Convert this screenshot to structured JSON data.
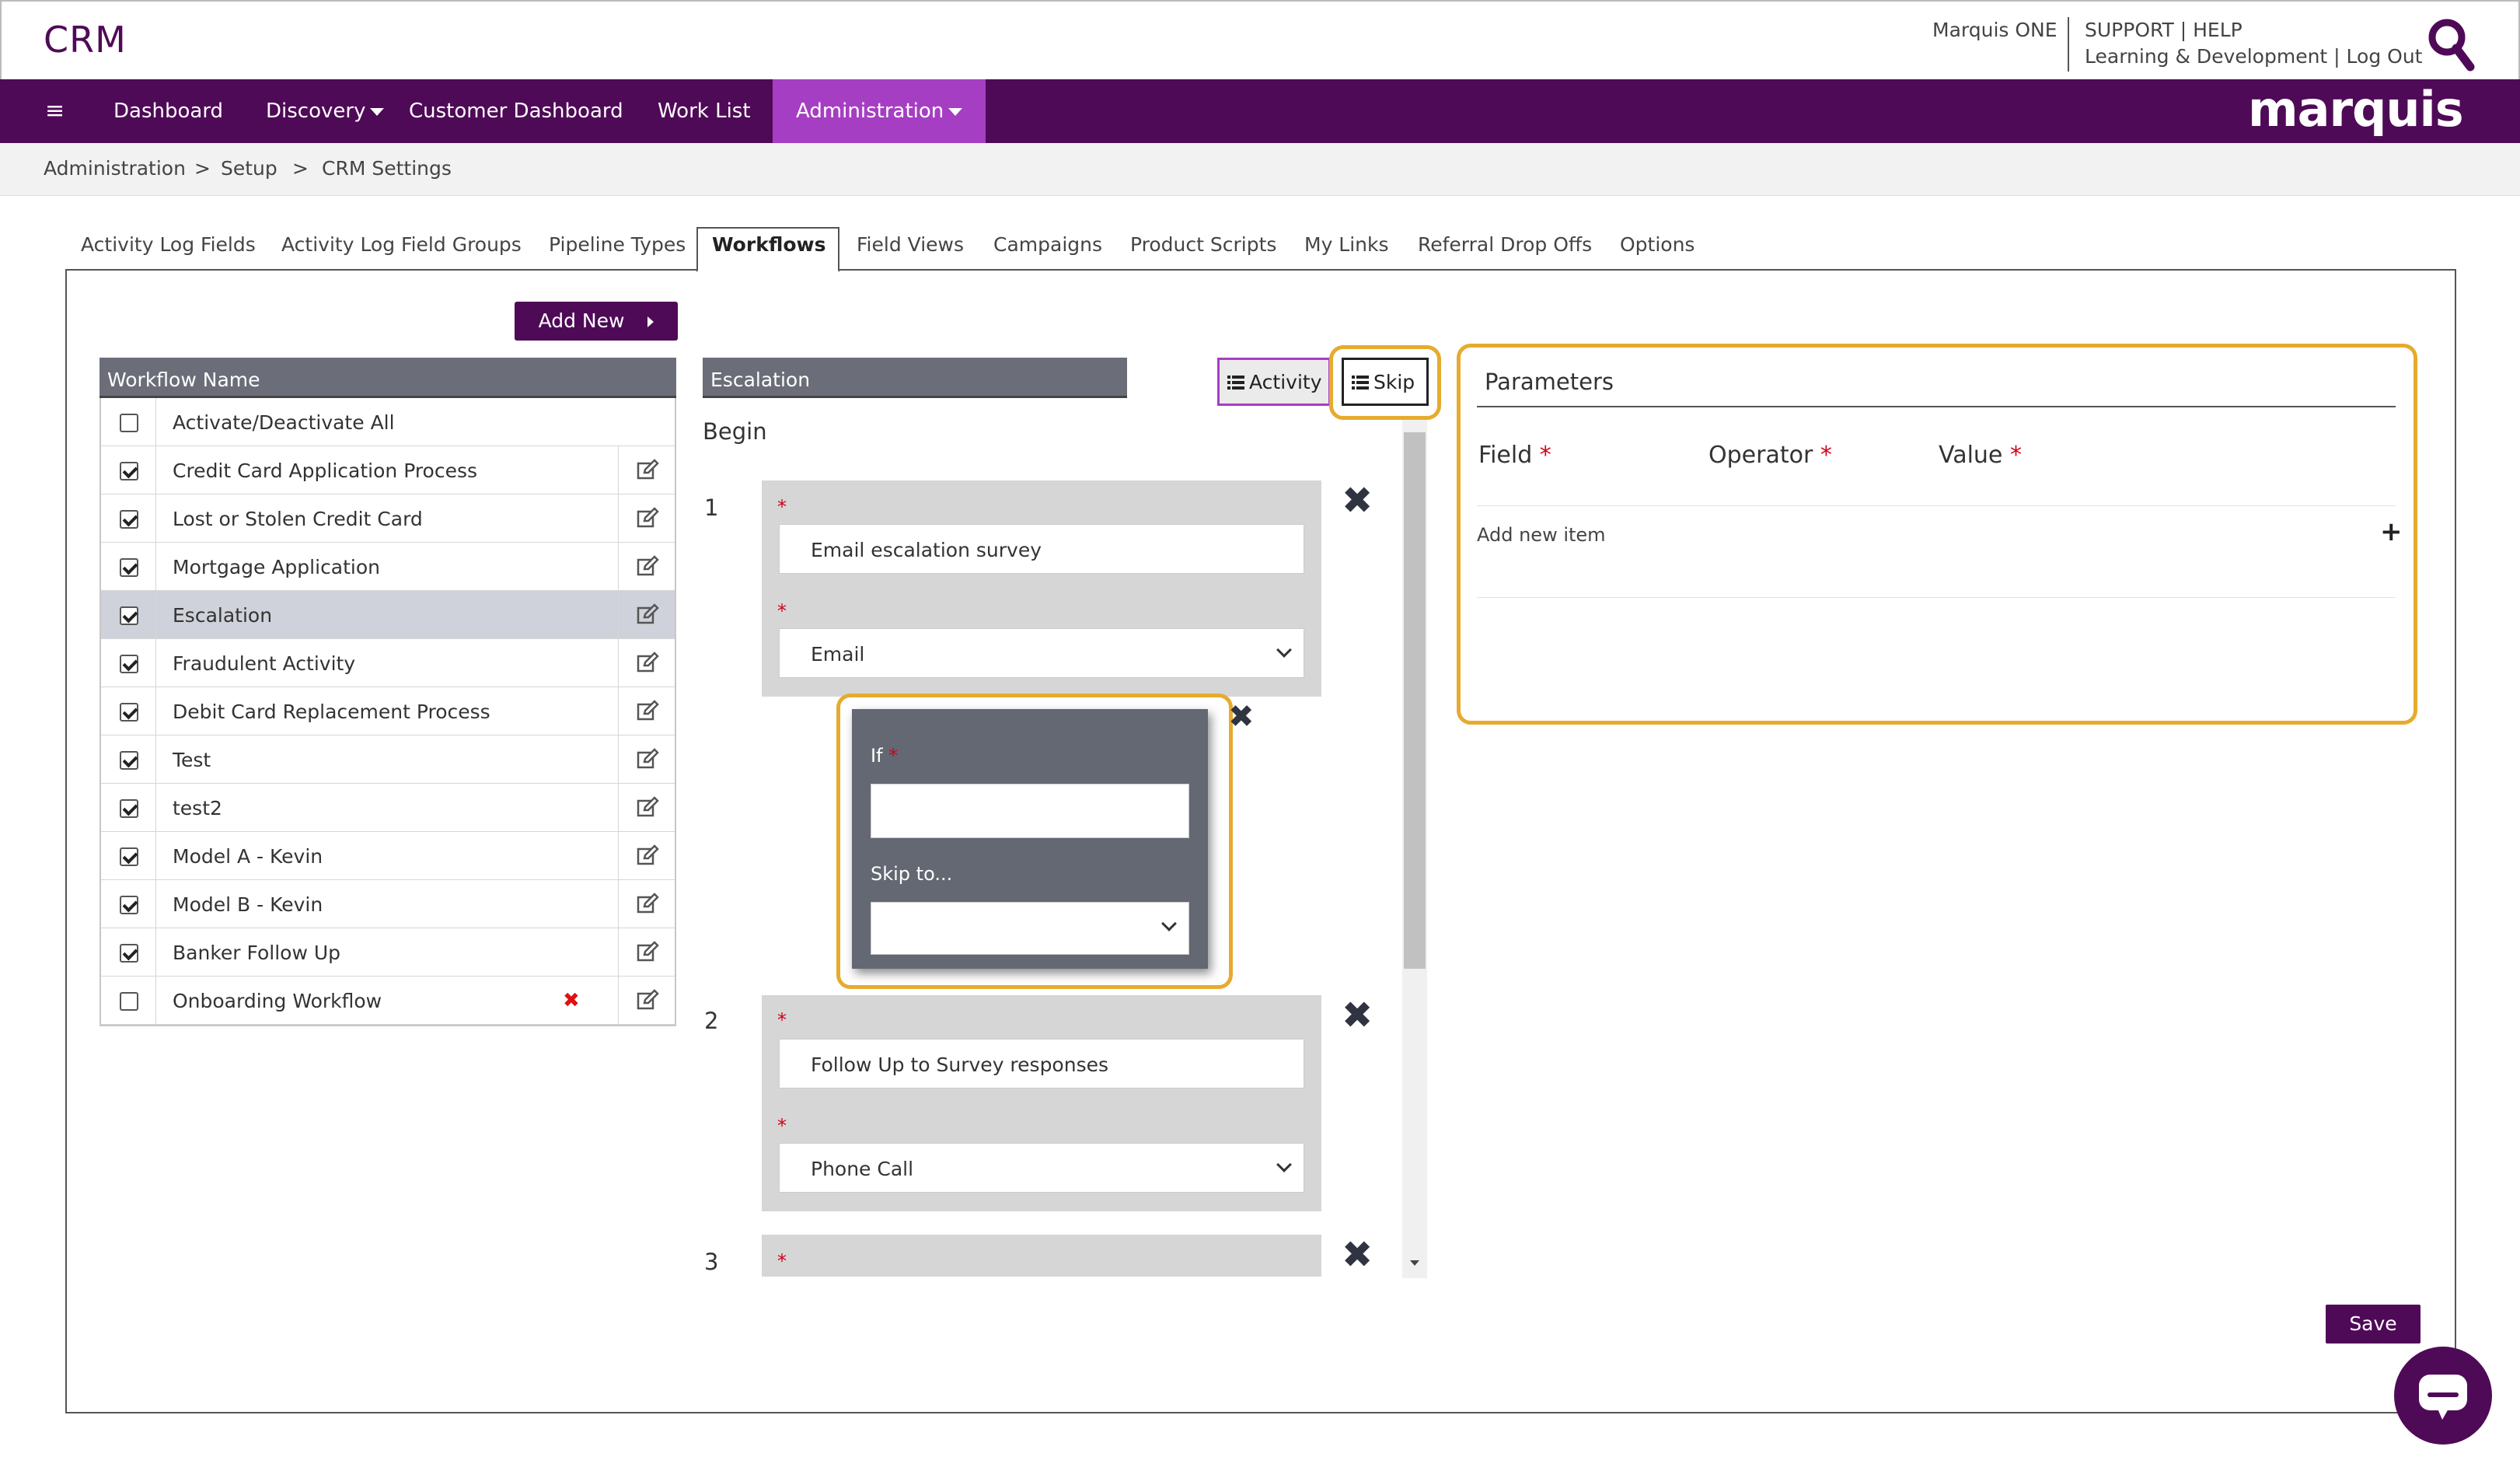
{
  "header": {
    "app_title": "CRM",
    "marquis_one": "Marquis ONE",
    "support_help": "SUPPORT | HELP",
    "learning_logout": "Learning & Development | Log Out"
  },
  "nav": {
    "items": [
      {
        "label": "Dashboard"
      },
      {
        "label": "Discovery"
      },
      {
        "label": "Customer Dashboard"
      },
      {
        "label": "Work List"
      },
      {
        "label": "Administration"
      }
    ],
    "brand": "marquis"
  },
  "breadcrumb": {
    "items": [
      "Administration",
      ">",
      "Setup",
      ">",
      "CRM Settings"
    ]
  },
  "tabs": [
    {
      "label": "Activity Log Fields"
    },
    {
      "label": "Activity Log Field Groups"
    },
    {
      "label": "Pipeline Types"
    },
    {
      "label": "Workflows"
    },
    {
      "label": "Field Views"
    },
    {
      "label": "Campaigns"
    },
    {
      "label": "Product Scripts"
    },
    {
      "label": "My Links"
    },
    {
      "label": "Referral Drop Offs"
    },
    {
      "label": "Options"
    }
  ],
  "buttons": {
    "add_new": "Add New",
    "activity": "Activity",
    "skip": "Skip",
    "save": "Save"
  },
  "workflow_list": {
    "header": "Workflow Name",
    "toggle_all": "Activate/Deactivate All",
    "rows": [
      {
        "name": "Credit Card Application Process",
        "checked": true
      },
      {
        "name": "Lost or Stolen Credit Card",
        "checked": true
      },
      {
        "name": "Mortgage Application",
        "checked": true
      },
      {
        "name": "Escalation",
        "checked": true,
        "selected": true
      },
      {
        "name": "Fraudulent Activity",
        "checked": true
      },
      {
        "name": "Debit Card Replacement Process",
        "checked": true
      },
      {
        "name": "Test",
        "checked": true
      },
      {
        "name": "test2",
        "checked": true
      },
      {
        "name": "Model A - Kevin",
        "checked": true
      },
      {
        "name": "Model B - Kevin",
        "checked": true
      },
      {
        "name": "Banker Follow Up",
        "checked": true
      },
      {
        "name": "Onboarding Workflow",
        "checked": false,
        "deletable": true
      }
    ]
  },
  "escalation": {
    "title": "Escalation",
    "begin": "Begin",
    "required_mark": "*",
    "steps": [
      {
        "number": "1",
        "name": "Email escalation survey",
        "type": "Email"
      },
      {
        "number": "2",
        "name": "Follow Up to Survey responses",
        "type": "Phone Call"
      },
      {
        "number": "3",
        "name": "",
        "type": ""
      }
    ],
    "skip_rule": {
      "if_label": "If",
      "skip_to_label": "Skip to...",
      "if_value": "",
      "skip_to_value": ""
    }
  },
  "parameters": {
    "title": "Parameters",
    "columns": [
      "Field",
      "Operator",
      "Value"
    ],
    "add_item": "Add new item"
  },
  "colors": {
    "brand_purple": "#4f0a57",
    "active_nav": "#a63ec3",
    "highlight": "#e6ab2e",
    "required": "#d0021b"
  }
}
